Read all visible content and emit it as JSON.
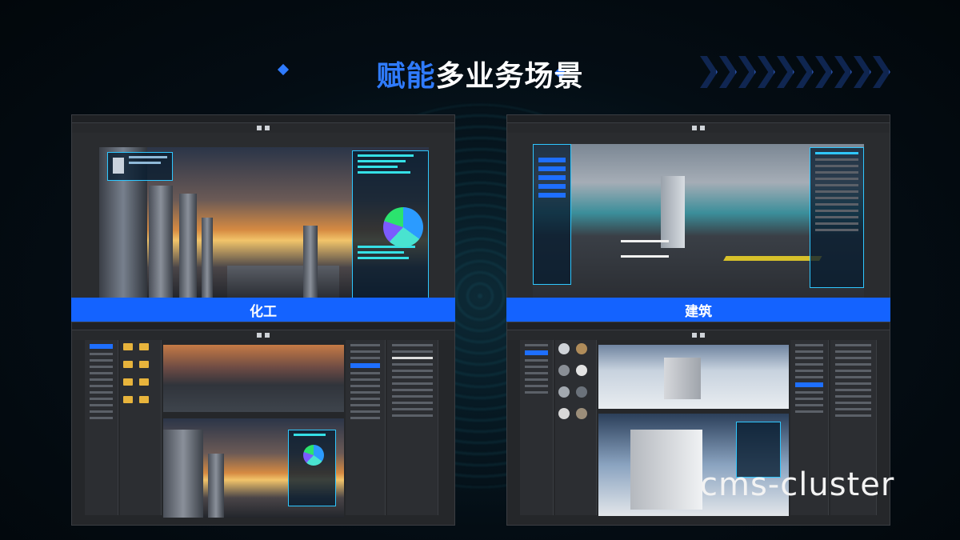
{
  "header": {
    "title_highlight": "赋能",
    "title_rest": "多业务场景"
  },
  "labels": {
    "chemical": "化工",
    "building": "建筑"
  },
  "watermark": "cms-cluster",
  "colors": {
    "accent": "#2f7bff",
    "label_bar": "#1463ff",
    "hud_cyan": "#2fc7ff"
  }
}
